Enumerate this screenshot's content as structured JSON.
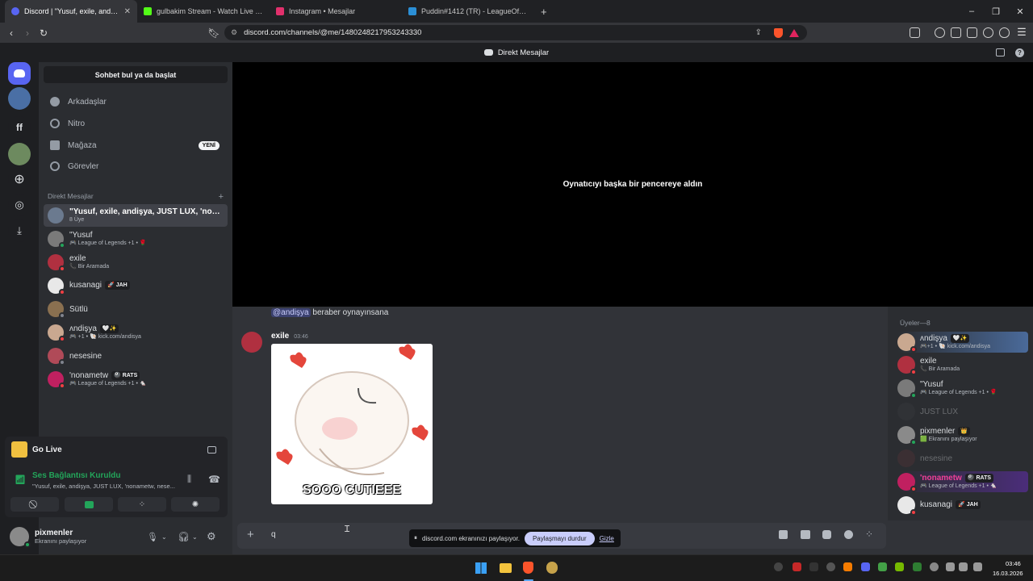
{
  "browser": {
    "tabs": [
      {
        "label": "Discord | \"Yusuf, exile, andişya, JUST LUX, 'nonametw, nese...",
        "color": "#5865f2",
        "active": true,
        "close": "✕"
      },
      {
        "label": "gulbakim Stream - Watch Live on Kick",
        "color": "#53fc18",
        "active": false,
        "close": ""
      },
      {
        "label": "Instagram • Mesajlar",
        "color": "#e1306c",
        "active": false,
        "close": ""
      },
      {
        "label": "Puddin#1412 (TR) - LeagueOfGraphs",
        "color": "#2b8fd6",
        "active": false,
        "close": ""
      }
    ],
    "new_tab": "+",
    "url": "discord.com/channels/@me/1480248217953243330",
    "window_controls": [
      "–",
      "❐",
      "✕"
    ]
  },
  "discord": {
    "header_title": "Direkt Mesajlar",
    "sidebar": {
      "search_label": "Sohbet bul ya da başlat",
      "nav": [
        {
          "label": "Arkadaşlar",
          "icon": "friends-icon"
        },
        {
          "label": "Nitro",
          "icon": "nitro-icon"
        },
        {
          "label": "Mağaza",
          "icon": "shop-icon",
          "badge": "YENİ"
        },
        {
          "label": "Görevler",
          "icon": "quests-icon"
        }
      ],
      "dm_header": "Direkt Mesajlar",
      "dm_add": "+",
      "dms": [
        {
          "name": "\"Yusuf, exile, andişya, JUST LUX, 'nona...",
          "sub": "8 Üye",
          "color": "#6b7a8f",
          "status": "",
          "tag": "",
          "selected": true
        },
        {
          "name": "\"Yusuf",
          "sub": "🎮 League of Legends +1 • 🌹",
          "color": "#7a7a7a",
          "status": "#23a55a",
          "tag": "",
          "selected": false
        },
        {
          "name": "exile",
          "sub": "📞 Bir Aramada",
          "color": "#b03040",
          "status": "#f23f43",
          "tag": "",
          "selected": false
        },
        {
          "name": "kusanagi",
          "sub": "",
          "color": "#e8e8e8",
          "status": "#f23f43",
          "tag": "🚀 JAH",
          "selected": false
        },
        {
          "name": "Sütlü",
          "sub": "",
          "color": "#8a7050",
          "status": "#80848e",
          "tag": "",
          "selected": false
        },
        {
          "name": "ᴧndişya",
          "sub": "🎮 +1 • 🐚 kick.com/andisya",
          "color": "#c9a890",
          "status": "#f23f43",
          "tag": "🤍✨",
          "selected": false
        },
        {
          "name": "nesesine",
          "sub": "",
          "color": "#b04a58",
          "status": "#80848e",
          "tag": "",
          "selected": false
        },
        {
          "name": "'nonametw",
          "sub": "🎮 League of Legends +1 • 🐁",
          "color": "#c02060",
          "status": "#f23f43",
          "tag": "🎱 RATS",
          "selected": false
        }
      ]
    },
    "panel": {
      "golive": "Go Live",
      "voice_status": "Ses Bağlantısı Kuruldu",
      "voice_channel": "\"Yusuf, exile, andişya, JUST LUX, 'nonametw, nese...",
      "user_name": "pixmenler",
      "user_status": "Ekranını paylaşıyor"
    },
    "stream_message": "Oynatıcıyı başka bir pencereye aldın",
    "messages": {
      "first_mention": "@andişya",
      "first_text": " beraber oynayınsana",
      "author": "exile",
      "time": "03:46",
      "gif_caption": "SOOO CUTIEEE"
    },
    "members": {
      "header": "Üyeler—8",
      "list": [
        {
          "name": "ᴧndişya",
          "tag": "🤍✨",
          "sub": "🎮+1 • 🐚 kick.com/andisya",
          "color": "#c9a890",
          "status": "#f23f43",
          "dim": false
        },
        {
          "name": "exile",
          "tag": "",
          "sub": "📞 Bir Aramada",
          "color": "#b03040",
          "status": "#f23f43",
          "dim": false
        },
        {
          "name": "\"Yusuf",
          "tag": "",
          "sub": "🎮 League of Legends +1 • 🌹",
          "color": "#7a7a7a",
          "status": "#23a55a",
          "dim": false
        },
        {
          "name": "JUST LUX",
          "tag": "",
          "sub": "",
          "color": "#3a3c42",
          "status": "",
          "dim": true
        },
        {
          "name": "pixmenler",
          "tag": "👑",
          "sub": "🟩 Ekranını paylaşıyor",
          "color": "#8a8a8a",
          "status": "#23a55a",
          "dim": false
        },
        {
          "name": "nesesine",
          "tag": "",
          "sub": "",
          "color": "#5a3438",
          "status": "",
          "dim": true
        },
        {
          "name": "'nonametw",
          "tag": "🎱 RATS",
          "sub": "🎮 League of Legends +1 • 🐁",
          "color": "#c02060",
          "status": "#f23f43",
          "dim": false
        },
        {
          "name": "kusanagi",
          "tag": "🚀 JAH",
          "sub": "",
          "color": "#e8e8e8",
          "status": "#f23f43",
          "dim": false
        }
      ]
    },
    "composer": {
      "add": "+",
      "text": "q",
      "share_text": "discord.com ekranınızı paylaşıyor.",
      "stop_label": "Paylaşmayı durdur",
      "hide_label": "Gizle"
    }
  },
  "taskbar": {
    "time": "03:46",
    "date": "16.03.2026"
  }
}
